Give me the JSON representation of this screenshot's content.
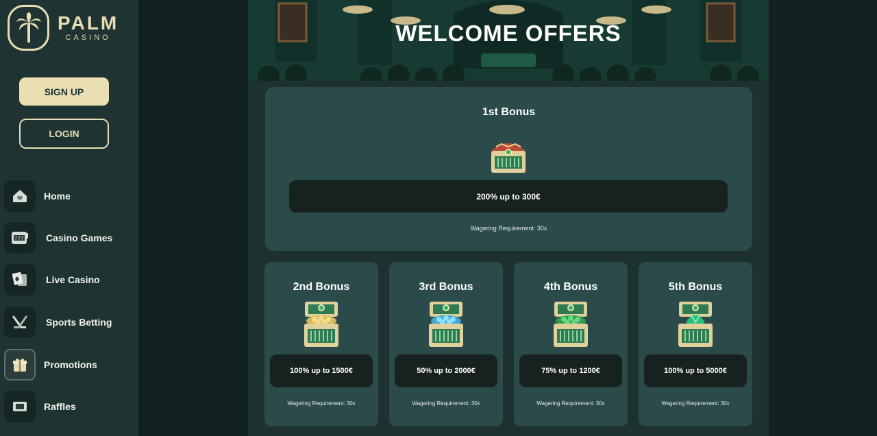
{
  "brand": {
    "title": "PALM",
    "subtitle": "CASINO",
    "logo_icon": "palm-tree-icon"
  },
  "auth": {
    "signup_label": "SIGN UP",
    "login_label": "LOGIN"
  },
  "sidebar": {
    "items": [
      {
        "label": "Home",
        "icon": "house-icon"
      },
      {
        "label": "Casino Games",
        "icon": "slot-machine-icon"
      },
      {
        "label": "Live Casino",
        "icon": "playing-cards-icon"
      },
      {
        "label": "Sports Betting",
        "icon": "hockey-sticks-icon"
      },
      {
        "label": "Promotions",
        "icon": "gift-icon",
        "active": true
      },
      {
        "label": "Raffles",
        "icon": "ticket-icon"
      }
    ]
  },
  "main": {
    "hero_title": "WELCOME OFFERS",
    "first_bonus": {
      "title": "1st Bonus",
      "offer": "200% up to 300€",
      "wagering": "Wagering Requirement: 30x"
    },
    "bonuses": [
      {
        "title": "2nd Bonus",
        "offer": "100% up to 1500€",
        "wagering": "Wagering Requirement: 30x",
        "chest": "gold-coins"
      },
      {
        "title": "3rd Bonus",
        "offer": "50% up to 2000€",
        "wagering": "Wagering Requirement: 30x",
        "chest": "blue-gems"
      },
      {
        "title": "4th Bonus",
        "offer": "75% up to 1200€",
        "wagering": "Wagering Requirement: 30x",
        "chest": "green-gems"
      },
      {
        "title": "5th Bonus",
        "offer": "100% up to 5000€",
        "wagering": "Wagering Requirement: 30x",
        "chest": "emerald"
      }
    ]
  },
  "colors": {
    "accent": "#e8ddb5",
    "sidebar_bg": "#1f3432",
    "card_bg": "#2b4a4a",
    "offer_bg": "#172220"
  }
}
